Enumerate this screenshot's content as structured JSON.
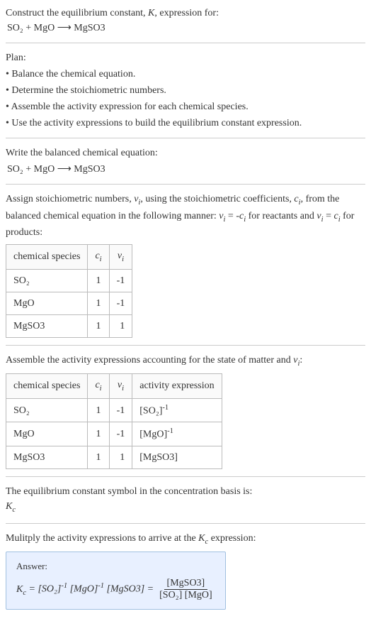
{
  "intro": {
    "line1": "Construct the equilibrium constant, K, expression for:",
    "equation": "SO₂ + MgO ⟶ MgSO3"
  },
  "plan": {
    "title": "Plan:",
    "bullets": [
      "• Balance the chemical equation.",
      "• Determine the stoichiometric numbers.",
      "• Assemble the activity expression for each chemical species.",
      "• Use the activity expressions to build the equilibrium constant expression."
    ]
  },
  "balanced": {
    "title": "Write the balanced chemical equation:",
    "equation": "SO₂ + MgO ⟶ MgSO3"
  },
  "stoich": {
    "intro": "Assign stoichiometric numbers, νᵢ, using the stoichiometric coefficients, cᵢ, from the balanced chemical equation in the following manner: νᵢ = -cᵢ for reactants and νᵢ = cᵢ for products:",
    "headers": [
      "chemical species",
      "cᵢ",
      "νᵢ"
    ],
    "rows": [
      [
        "SO₂",
        "1",
        "-1"
      ],
      [
        "MgO",
        "1",
        "-1"
      ],
      [
        "MgSO3",
        "1",
        "1"
      ]
    ]
  },
  "activity": {
    "intro": "Assemble the activity expressions accounting for the state of matter and νᵢ:",
    "headers": [
      "chemical species",
      "cᵢ",
      "νᵢ",
      "activity expression"
    ],
    "rows": [
      [
        "SO₂",
        "1",
        "-1",
        "[SO₂]⁻¹"
      ],
      [
        "MgO",
        "1",
        "-1",
        "[MgO]⁻¹"
      ],
      [
        "MgSO3",
        "1",
        "1",
        "[MgSO3]"
      ]
    ]
  },
  "kcbasis": {
    "line1": "The equilibrium constant symbol in the concentration basis is:",
    "symbol": "K𝒸"
  },
  "multiply": {
    "line": "Mulitply the activity expressions to arrive at the K𝒸 expression:"
  },
  "answer": {
    "label": "Answer:",
    "lhs": "K𝒸 = [SO₂]⁻¹ [MgO]⁻¹ [MgSO3] =",
    "num": "[MgSO3]",
    "den": "[SO₂] [MgO]"
  }
}
